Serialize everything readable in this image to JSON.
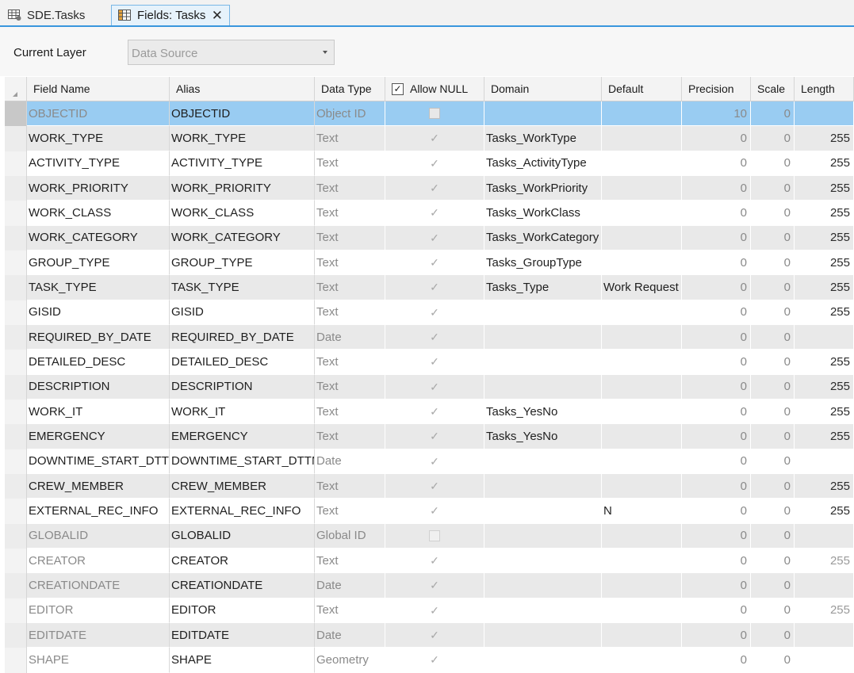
{
  "tabs": [
    {
      "label": "SDE.Tasks",
      "icon": "table-icon",
      "active": false
    },
    {
      "label": "Fields: Tasks",
      "icon": "fields-table-icon",
      "active": true
    }
  ],
  "current_layer": {
    "label": "Current Layer",
    "value": "Data Source"
  },
  "columns": [
    "Field Name",
    "Alias",
    "Data Type",
    "Allow NULL",
    "Domain",
    "Default",
    "Precision",
    "Scale",
    "Length"
  ],
  "rows": [
    {
      "field_name": "OBJECTID",
      "alias": "OBJECTID",
      "data_type": "Object ID",
      "allow_null": false,
      "domain": "",
      "default": "",
      "precision": "10",
      "scale": "0",
      "length": "",
      "system": true
    },
    {
      "field_name": "WORK_TYPE",
      "alias": "WORK_TYPE",
      "data_type": "Text",
      "allow_null": true,
      "domain": "Tasks_WorkType",
      "default": "",
      "precision": "0",
      "scale": "0",
      "length": "255",
      "system": false
    },
    {
      "field_name": "ACTIVITY_TYPE",
      "alias": "ACTIVITY_TYPE",
      "data_type": "Text",
      "allow_null": true,
      "domain": "Tasks_ActivityType",
      "default": "",
      "precision": "0",
      "scale": "0",
      "length": "255",
      "system": false
    },
    {
      "field_name": "WORK_PRIORITY",
      "alias": "WORK_PRIORITY",
      "data_type": "Text",
      "allow_null": true,
      "domain": "Tasks_WorkPriority",
      "default": "",
      "precision": "0",
      "scale": "0",
      "length": "255",
      "system": false
    },
    {
      "field_name": "WORK_CLASS",
      "alias": "WORK_CLASS",
      "data_type": "Text",
      "allow_null": true,
      "domain": "Tasks_WorkClass",
      "default": "",
      "precision": "0",
      "scale": "0",
      "length": "255",
      "system": false
    },
    {
      "field_name": "WORK_CATEGORY",
      "alias": "WORK_CATEGORY",
      "data_type": "Text",
      "allow_null": true,
      "domain": "Tasks_WorkCategory",
      "default": "",
      "precision": "0",
      "scale": "0",
      "length": "255",
      "system": false
    },
    {
      "field_name": "GROUP_TYPE",
      "alias": "GROUP_TYPE",
      "data_type": "Text",
      "allow_null": true,
      "domain": "Tasks_GroupType",
      "default": "",
      "precision": "0",
      "scale": "0",
      "length": "255",
      "system": false
    },
    {
      "field_name": "TASK_TYPE",
      "alias": "TASK_TYPE",
      "data_type": "Text",
      "allow_null": true,
      "domain": "Tasks_Type",
      "default": "Work Request",
      "precision": "0",
      "scale": "0",
      "length": "255",
      "system": false
    },
    {
      "field_name": "GISID",
      "alias": "GISID",
      "data_type": "Text",
      "allow_null": true,
      "domain": "",
      "default": "",
      "precision": "0",
      "scale": "0",
      "length": "255",
      "system": false
    },
    {
      "field_name": "REQUIRED_BY_DATE",
      "alias": "REQUIRED_BY_DATE",
      "data_type": "Date",
      "allow_null": true,
      "domain": "",
      "default": "",
      "precision": "0",
      "scale": "0",
      "length": "",
      "system": false
    },
    {
      "field_name": "DETAILED_DESC",
      "alias": "DETAILED_DESC",
      "data_type": "Text",
      "allow_null": true,
      "domain": "",
      "default": "",
      "precision": "0",
      "scale": "0",
      "length": "255",
      "system": false
    },
    {
      "field_name": "DESCRIPTION",
      "alias": "DESCRIPTION",
      "data_type": "Text",
      "allow_null": true,
      "domain": "",
      "default": "",
      "precision": "0",
      "scale": "0",
      "length": "255",
      "system": false
    },
    {
      "field_name": "WORK_IT",
      "alias": "WORK_IT",
      "data_type": "Text",
      "allow_null": true,
      "domain": "Tasks_YesNo",
      "default": "",
      "precision": "0",
      "scale": "0",
      "length": "255",
      "system": false
    },
    {
      "field_name": "EMERGENCY",
      "alias": "EMERGENCY",
      "data_type": "Text",
      "allow_null": true,
      "domain": "Tasks_YesNo",
      "default": "",
      "precision": "0",
      "scale": "0",
      "length": "255",
      "system": false
    },
    {
      "field_name": "DOWNTIME_START_DTTM",
      "alias": "DOWNTIME_START_DTTM",
      "data_type": "Date",
      "allow_null": true,
      "domain": "",
      "default": "",
      "precision": "0",
      "scale": "0",
      "length": "",
      "system": false
    },
    {
      "field_name": "CREW_MEMBER",
      "alias": "CREW_MEMBER",
      "data_type": "Text",
      "allow_null": true,
      "domain": "",
      "default": "",
      "precision": "0",
      "scale": "0",
      "length": "255",
      "system": false
    },
    {
      "field_name": "EXTERNAL_REC_INFO",
      "alias": "EXTERNAL_REC_INFO",
      "data_type": "Text",
      "allow_null": true,
      "domain": "",
      "default": "N",
      "precision": "0",
      "scale": "0",
      "length": "255",
      "system": false
    },
    {
      "field_name": "GLOBALID",
      "alias": "GLOBALID",
      "data_type": "Global ID",
      "allow_null": false,
      "domain": "",
      "default": "",
      "precision": "0",
      "scale": "0",
      "length": "",
      "system": true
    },
    {
      "field_name": "CREATOR",
      "alias": "CREATOR",
      "data_type": "Text",
      "allow_null": true,
      "domain": "",
      "default": "",
      "precision": "0",
      "scale": "0",
      "length": "255",
      "system": true
    },
    {
      "field_name": "CREATIONDATE",
      "alias": "CREATIONDATE",
      "data_type": "Date",
      "allow_null": true,
      "domain": "",
      "default": "",
      "precision": "0",
      "scale": "0",
      "length": "",
      "system": true
    },
    {
      "field_name": "EDITOR",
      "alias": "EDITOR",
      "data_type": "Text",
      "allow_null": true,
      "domain": "",
      "default": "",
      "precision": "0",
      "scale": "0",
      "length": "255",
      "system": true
    },
    {
      "field_name": "EDITDATE",
      "alias": "EDITDATE",
      "data_type": "Date",
      "allow_null": true,
      "domain": "",
      "default": "",
      "precision": "0",
      "scale": "0",
      "length": "",
      "system": true
    },
    {
      "field_name": "SHAPE",
      "alias": "SHAPE",
      "data_type": "Geometry",
      "allow_null": true,
      "domain": "",
      "default": "",
      "precision": "0",
      "scale": "0",
      "length": "",
      "system": true
    }
  ]
}
